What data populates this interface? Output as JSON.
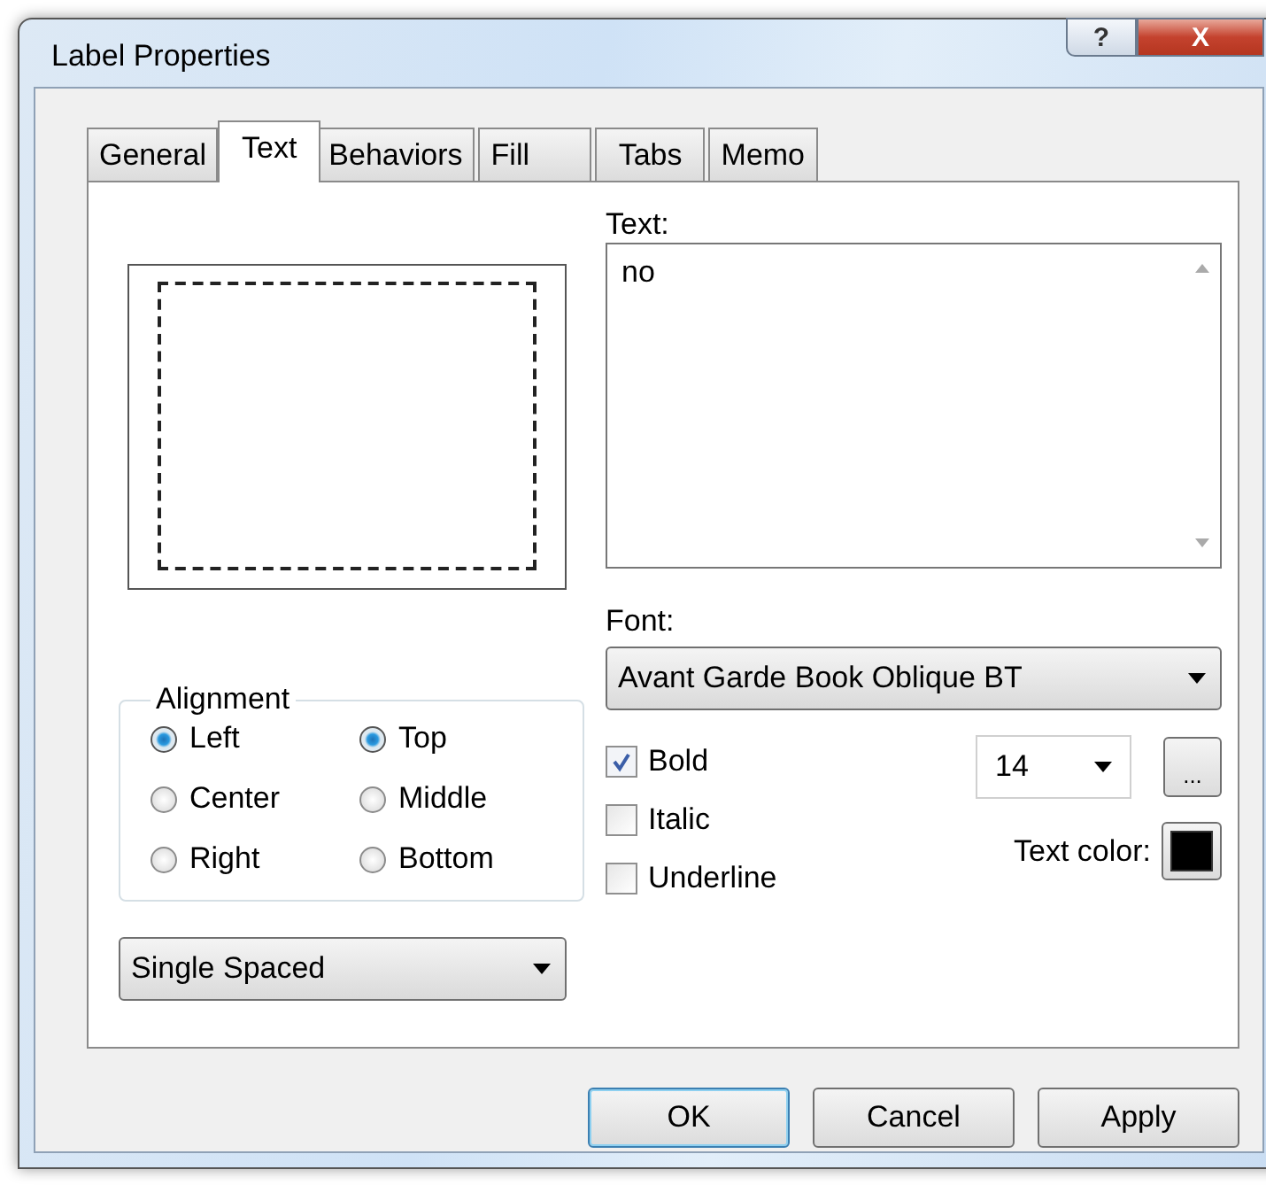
{
  "window": {
    "title": "Label Properties",
    "help_button": "?",
    "close_button": "X"
  },
  "tabs": [
    {
      "label": "General",
      "selected": false
    },
    {
      "label": "Text",
      "selected": true
    },
    {
      "label": "Behaviors",
      "selected": false
    },
    {
      "label": "Fill",
      "selected": false
    },
    {
      "label": "Tabs",
      "selected": false
    },
    {
      "label": "Memo",
      "selected": false
    }
  ],
  "text_label": "Text:",
  "text_value": "no",
  "alignment": {
    "title": "Alignment",
    "horizontal": [
      {
        "label": "Left",
        "selected": true
      },
      {
        "label": "Center",
        "selected": false
      },
      {
        "label": "Right",
        "selected": false
      }
    ],
    "vertical": [
      {
        "label": "Top",
        "selected": true
      },
      {
        "label": "Middle",
        "selected": false
      },
      {
        "label": "Bottom",
        "selected": false
      }
    ]
  },
  "spacing": "Single Spaced",
  "font_label": "Font:",
  "font": "Avant Garde Book Oblique BT",
  "styles": [
    {
      "label": "Bold",
      "checked": true
    },
    {
      "label": "Italic",
      "checked": false
    },
    {
      "label": "Underline",
      "checked": false
    }
  ],
  "size": "14",
  "more_button": "...",
  "text_color_label": "Text color:",
  "text_color_swatch": {
    "color": "#000000"
  },
  "buttons": [
    {
      "label": "OK",
      "default": true
    },
    {
      "label": "Cancel",
      "default": false
    },
    {
      "label": "Apply",
      "default": false
    }
  ]
}
